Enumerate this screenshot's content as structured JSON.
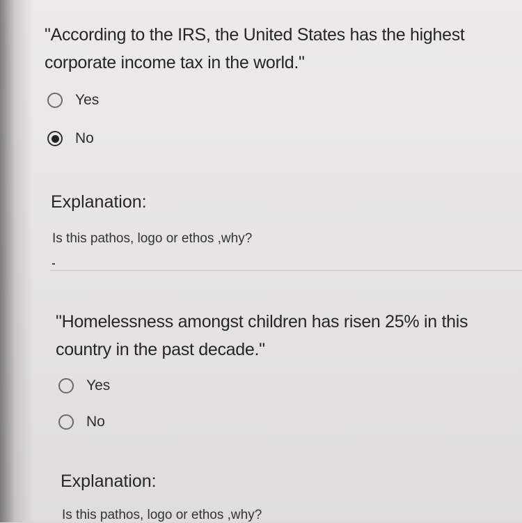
{
  "questions": [
    {
      "prompt_line1": "\"According to the IRS, the United States has the highest",
      "prompt_line2": "corporate income tax in the world.\"",
      "options": [
        {
          "label": "Yes",
          "selected": false
        },
        {
          "label": "No",
          "selected": true
        }
      ],
      "explanation_title": "Explanation:",
      "explanation_help": "Is this pathos, logo or ethos ,why?"
    },
    {
      "prompt_line1": "\"Homelessness amongst children has risen 25% in this",
      "prompt_line2": "country in the past decade.\"",
      "options": [
        {
          "label": "Yes",
          "selected": false
        },
        {
          "label": "No",
          "selected": false
        }
      ],
      "explanation_title": "Explanation:",
      "explanation_help": "Is this pathos, logo or ethos ,why?"
    }
  ]
}
